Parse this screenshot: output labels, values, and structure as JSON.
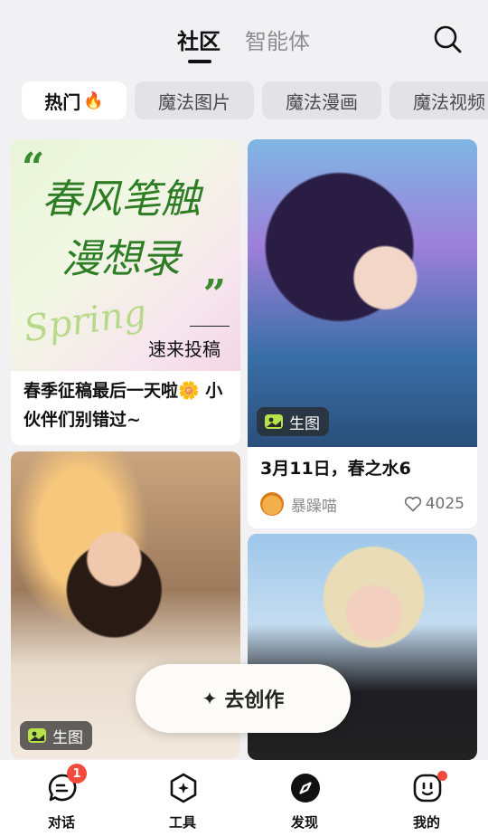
{
  "header": {
    "tabs": [
      {
        "label": "社区",
        "active": true
      },
      {
        "label": "智能体",
        "active": false
      }
    ],
    "search_icon": "search-icon"
  },
  "chips": [
    {
      "label": "热门",
      "emoji": "🔥",
      "active": true
    },
    {
      "label": "魔法图片",
      "active": false
    },
    {
      "label": "魔法漫画",
      "active": false
    },
    {
      "label": "魔法视频",
      "active": false
    }
  ],
  "feed": {
    "card1": {
      "poster": {
        "quote_open": "“",
        "line1": "春风笔触",
        "line2": "漫想录",
        "quote_close": "”",
        "spring": "Spring",
        "cta": "速来投稿"
      },
      "title": "春季征稿最后一天啦🌼 小伙伴们别错过~"
    },
    "card2": {
      "badge": "生图",
      "title": "3月11日，春之水6",
      "author": "暴躁喵",
      "likes": "4025"
    },
    "card3": {
      "badge": "生图"
    },
    "card4": {}
  },
  "create_button": {
    "icon": "✦",
    "label": "去创作"
  },
  "bottom_nav": [
    {
      "label": "对话",
      "icon": "chat-icon",
      "badge": "1"
    },
    {
      "label": "工具",
      "icon": "tools-icon"
    },
    {
      "label": "发现",
      "icon": "compass-icon"
    },
    {
      "label": "我的",
      "icon": "profile-icon",
      "dot": true
    }
  ],
  "colors": {
    "accent_red": "#f24b3d",
    "background": "#f1f1f3",
    "poster_green": "#2d7d25"
  }
}
